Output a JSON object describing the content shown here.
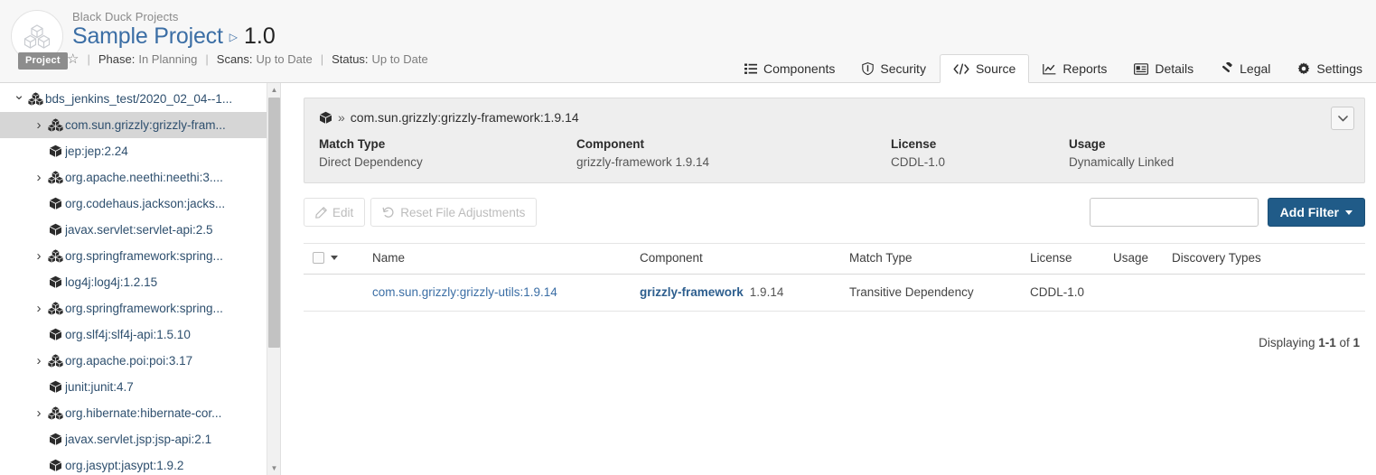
{
  "header": {
    "breadcrumb_top": "Black Duck Projects",
    "project_name": "Sample Project",
    "separator": "▷",
    "version": "1.0",
    "badge": "Project",
    "star_icon": "star-outline-icon",
    "logo_icon": "cubes-logo-icon",
    "meta": {
      "phase_label": "Phase:",
      "phase_value": "In Planning",
      "scans_label": "Scans:",
      "scans_value": "Up to Date",
      "status_label": "Status:",
      "status_value": "Up to Date",
      "pipe": "|"
    },
    "tabs": [
      {
        "label": "Components",
        "icon": "list-icon",
        "active": false
      },
      {
        "label": "Security",
        "icon": "shield-icon",
        "active": false
      },
      {
        "label": "Source",
        "icon": "code-icon",
        "active": true
      },
      {
        "label": "Reports",
        "icon": "chart-icon",
        "active": false
      },
      {
        "label": "Details",
        "icon": "id-card-icon",
        "active": false
      },
      {
        "label": "Legal",
        "icon": "gavel-icon",
        "active": false
      },
      {
        "label": "Settings",
        "icon": "gear-icon",
        "active": false
      }
    ]
  },
  "sidebar": {
    "scrollbar": {
      "up_arrow": "▲",
      "down_arrow": "▼"
    },
    "tree": [
      {
        "label": "bds_jenkins_test/2020_02_04--1...",
        "depth": 0,
        "caret": "expanded",
        "icon": "multi-package-icon",
        "selected": false
      },
      {
        "label": "com.sun.grizzly:grizzly-fram...",
        "depth": 1,
        "caret": "collapsed",
        "icon": "multi-package-icon",
        "selected": true
      },
      {
        "label": "jep:jep:2.24",
        "depth": 1,
        "caret": "none",
        "icon": "package-icon",
        "selected": false
      },
      {
        "label": "org.apache.neethi:neethi:3....",
        "depth": 1,
        "caret": "collapsed",
        "icon": "multi-package-icon",
        "selected": false
      },
      {
        "label": "org.codehaus.jackson:jacks...",
        "depth": 1,
        "caret": "none",
        "icon": "package-icon",
        "selected": false
      },
      {
        "label": "javax.servlet:servlet-api:2.5",
        "depth": 1,
        "caret": "none",
        "icon": "package-icon",
        "selected": false
      },
      {
        "label": "org.springframework:spring...",
        "depth": 1,
        "caret": "collapsed",
        "icon": "multi-package-icon",
        "selected": false
      },
      {
        "label": "log4j:log4j:1.2.15",
        "depth": 1,
        "caret": "none",
        "icon": "package-icon",
        "selected": false
      },
      {
        "label": "org.springframework:spring...",
        "depth": 1,
        "caret": "collapsed",
        "icon": "multi-package-icon",
        "selected": false
      },
      {
        "label": "org.slf4j:slf4j-api:1.5.10",
        "depth": 1,
        "caret": "none",
        "icon": "package-icon",
        "selected": false
      },
      {
        "label": "org.apache.poi:poi:3.17",
        "depth": 1,
        "caret": "collapsed",
        "icon": "multi-package-icon",
        "selected": false
      },
      {
        "label": "junit:junit:4.7",
        "depth": 1,
        "caret": "none",
        "icon": "package-icon",
        "selected": false
      },
      {
        "label": "org.hibernate:hibernate-cor...",
        "depth": 1,
        "caret": "collapsed",
        "icon": "multi-package-icon",
        "selected": false
      },
      {
        "label": "javax.servlet.jsp:jsp-api:2.1",
        "depth": 1,
        "caret": "none",
        "icon": "package-icon",
        "selected": false
      },
      {
        "label": "org.jasypt:jasypt:1.9.2",
        "depth": 1,
        "caret": "none",
        "icon": "package-icon",
        "selected": false
      }
    ]
  },
  "detail_panel": {
    "icon": "package-icon",
    "prefix": "»",
    "title": "com.sun.grizzly:grizzly-framework:1.9.14",
    "collapse_icon": "chevron-down-icon",
    "fields": [
      {
        "label": "Match Type",
        "value": "Direct Dependency"
      },
      {
        "label": "Component",
        "value": "grizzly-framework 1.9.14"
      },
      {
        "label": "License",
        "value": "CDDL-1.0"
      },
      {
        "label": "Usage",
        "value": "Dynamically Linked"
      }
    ]
  },
  "toolbar": {
    "edit_label": "Edit",
    "edit_icon": "pencil-icon",
    "reset_label": "Reset File Adjustments",
    "reset_icon": "undo-icon",
    "filter_value": "",
    "filter_placeholder": "",
    "add_filter_label": "Add Filter"
  },
  "table": {
    "select_all_icon": "checkbox-icon",
    "sort_caret_icon": "caret-down-icon",
    "columns": [
      "",
      "Name",
      "Component",
      "Match Type",
      "License",
      "Usage",
      "Discovery Types"
    ],
    "rows": [
      {
        "name": "com.sun.grizzly:grizzly-utils:1.9.14",
        "component_name": "grizzly-framework",
        "component_version": "1.9.14",
        "match_type": "Transitive Dependency",
        "license": "CDDL-1.0",
        "usage": "",
        "discovery_types": ""
      }
    ]
  },
  "footer": {
    "displaying_prefix": "Displaying ",
    "displaying_range": "1-1",
    "displaying_mid": " of ",
    "displaying_total": "1"
  },
  "colors": {
    "accent": "#205b88",
    "link": "#3b6ea5",
    "panel_bg": "#eeeeee",
    "selected_row": "#d6d6d6"
  }
}
